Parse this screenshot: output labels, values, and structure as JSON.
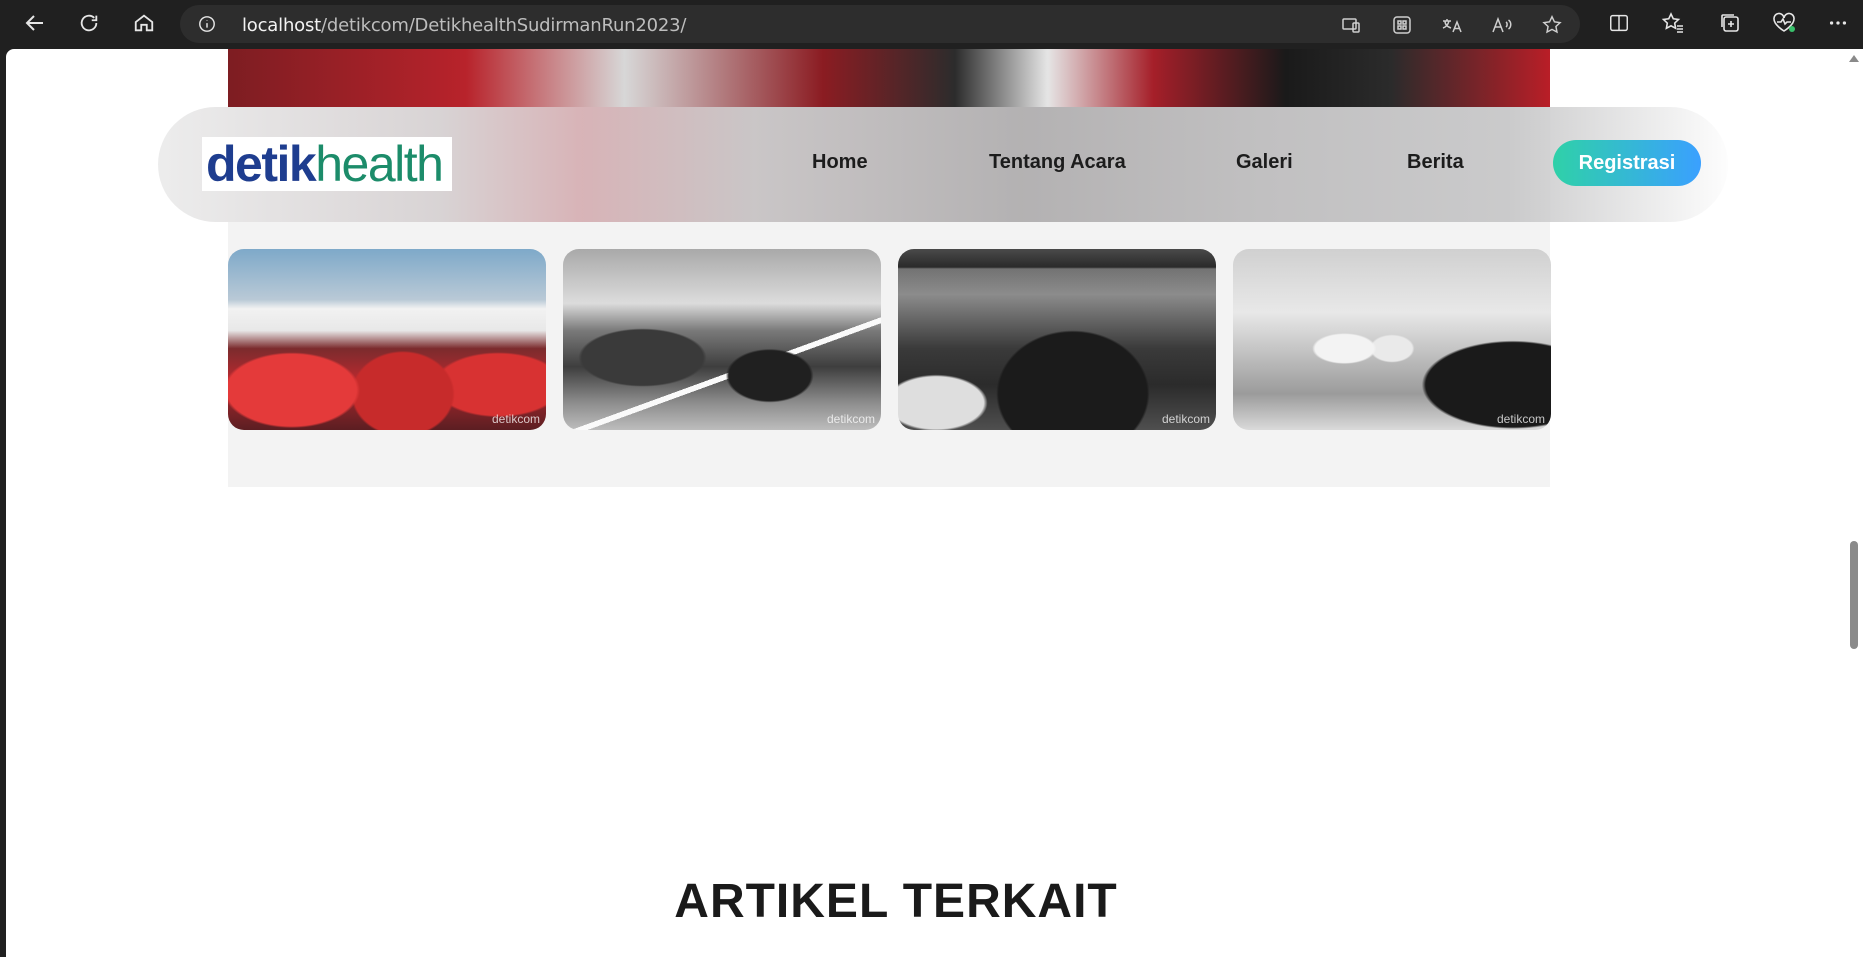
{
  "browser": {
    "url_host": "localhost",
    "url_path": "/detikcom/DetikhealthSudirmanRun2023/"
  },
  "navbar": {
    "logo_part1": "detik",
    "logo_part2": "health",
    "links": [
      "Home",
      "Tentang Acara",
      "Galeri",
      "Berita"
    ],
    "register_label": "Registrasi"
  },
  "gallery": {
    "watermark": "detikcom"
  },
  "section": {
    "title": "ARTIKEL TERKAIT"
  },
  "colors": {
    "logo_blue": "#1e3d8f",
    "logo_green": "#1c8c6a",
    "button_gradient_start": "#2fd1a8",
    "button_gradient_end": "#3aa0ff"
  },
  "icons": [
    "back-icon",
    "refresh-icon",
    "home-icon",
    "info-icon",
    "cast-icon",
    "apps-icon",
    "translate-icon",
    "read-aloud-icon",
    "favorite-star-icon",
    "split-screen-icon",
    "favorites-icon",
    "collections-icon",
    "health-icon",
    "more-icon"
  ]
}
